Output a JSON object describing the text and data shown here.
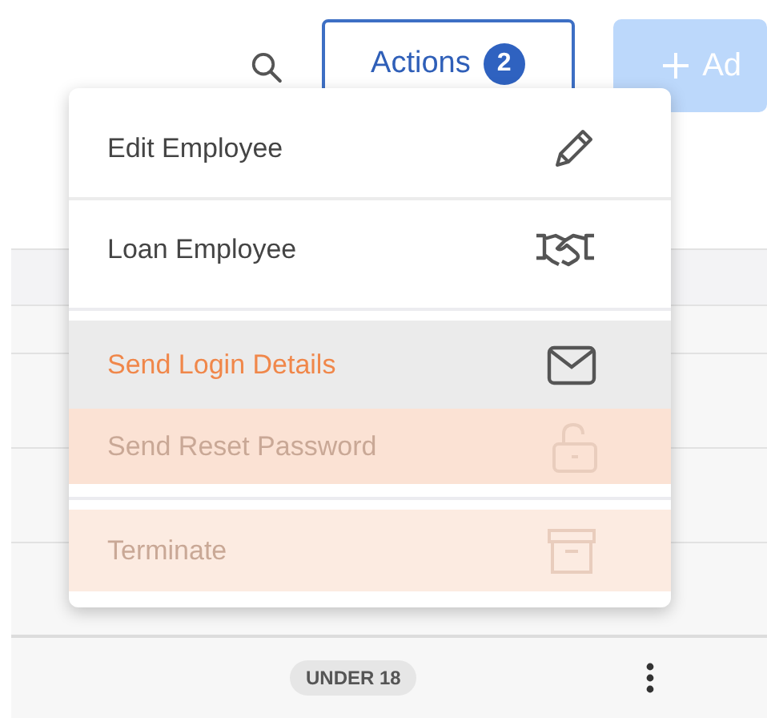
{
  "toolbar": {
    "actions_button": {
      "label": "Actions",
      "badge": "2"
    },
    "add_button": {
      "label": "Ad"
    }
  },
  "actions_menu": {
    "sections": [
      {
        "items": [
          {
            "label": "Edit Employee",
            "highlighted": false,
            "disabled": false
          },
          {
            "label": "Loan Employee",
            "highlighted": false,
            "disabled": false
          }
        ]
      },
      {
        "items": [
          {
            "label": "Send Login Details",
            "highlighted": true,
            "disabled": false
          },
          {
            "label": "Send Reset Password",
            "highlighted": false,
            "disabled": true
          }
        ]
      },
      {
        "items": [
          {
            "label": "Terminate",
            "highlighted": false,
            "disabled": true
          }
        ]
      }
    ]
  },
  "table": {
    "rows": [
      {
        "tag": "UNDER 18"
      }
    ]
  }
}
